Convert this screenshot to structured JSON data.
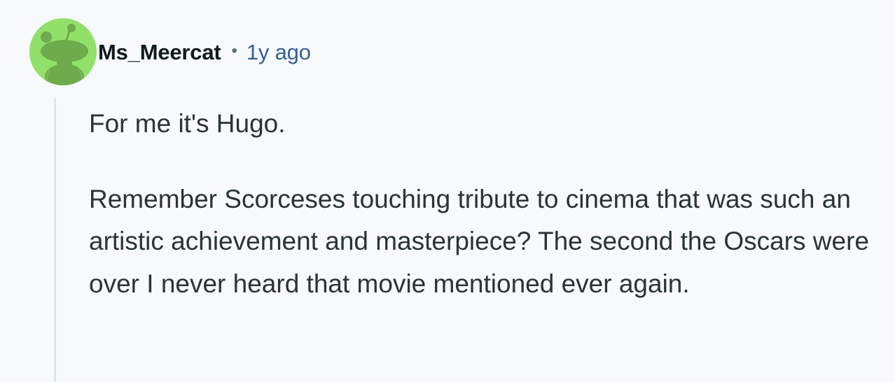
{
  "comment": {
    "author": "Ms_Meercat",
    "separator": "•",
    "time_ago": "1y ago",
    "paragraphs": [
      "For me it's Hugo.",
      "Remember Scorceses touching tribute to cinema that was such an artistic achievement and masterpiece? The second the Oscars were over I never heard that movie mentioned ever again."
    ]
  },
  "avatar": {
    "icon": "snoo-avatar-icon",
    "background_color": "#91e06a",
    "figure_color": "#6eab4d"
  },
  "colors": {
    "background": "#f7f9fc",
    "username": "#0f1a1c",
    "timestamp": "#355f93",
    "body_text": "#2a3438",
    "thread_line": "#d8e5f2"
  }
}
